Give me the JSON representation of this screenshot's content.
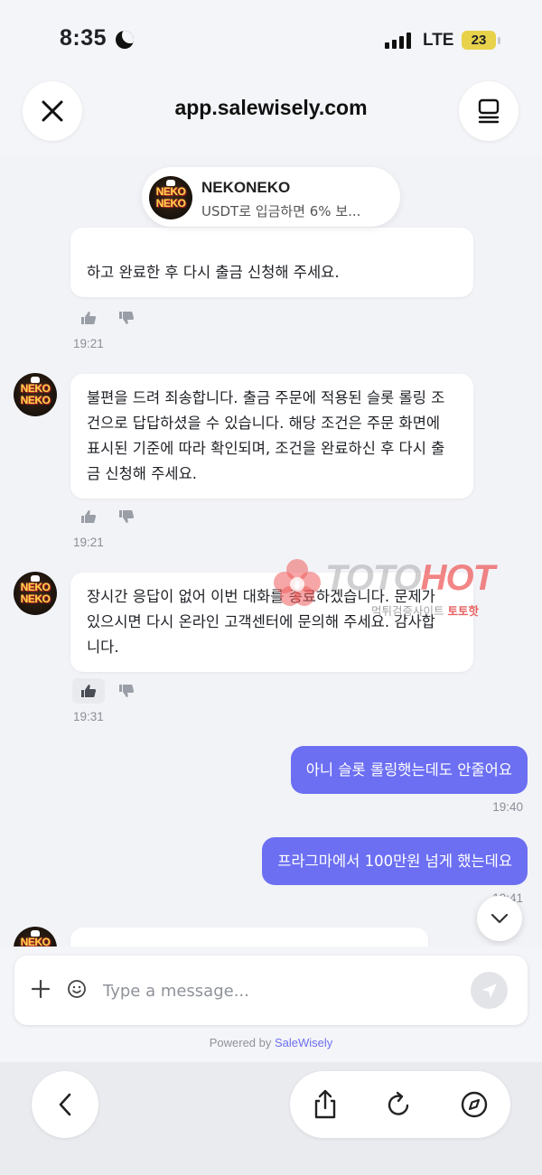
{
  "status_bar": {
    "time": "8:35",
    "network": "LTE",
    "battery": "23"
  },
  "browser": {
    "url": "app.salewisely.com"
  },
  "chat": {
    "header_pill": {
      "name": "NEKONEKO",
      "preview": "USDT로 입금하면 6% 보..."
    },
    "logo_text": [
      "NEKO",
      "NEKO"
    ],
    "messages": [
      {
        "type": "agent",
        "lines": [
          "하고 완료한 후 다시 출금 신청해 주세요."
        ],
        "time": "19:21",
        "liked": false
      },
      {
        "type": "agent",
        "lines": [
          "불편을 드려 죄송합니다. 출금 주문에 적용된 슬롯 롤링 조",
          "건으로 답답하셨을 수 있습니다. 해당 조건은 주문 화면에",
          "표시된 기준에 따라 확인되며, 조건을 완료하신 후 다시 출",
          "금 신청해 주세요."
        ],
        "time": "19:21",
        "liked": false
      },
      {
        "type": "agent",
        "lines": [
          "장시간 응답이 없어 이번 대화를 종료하겠습니다. 문제가",
          "있으시면 다시 온라인 고객센터에 문의해 주세요. 감사합",
          "니다."
        ],
        "time": "19:31",
        "liked": true
      },
      {
        "type": "user",
        "text": "아니 슬롯 롤링햇는데도 안줄어요",
        "time": "19:40"
      },
      {
        "type": "user",
        "text": "프라그마에서 100만원 넘게 했는데요",
        "time": "19:41"
      }
    ]
  },
  "watermark": {
    "brand_a": "TOTO",
    "brand_b": "HOT",
    "sub_a": "먹튀검증사이트 ",
    "sub_b": "토토핫"
  },
  "composer": {
    "placeholder": "Type a message...",
    "powered_prefix": "Powered by ",
    "powered_brand": "SaleWisely"
  },
  "colors": {
    "accent": "#6c6ff2",
    "background": "#f2f3f7",
    "bubble_in": "#ffffff"
  },
  "icons": [
    "close-icon",
    "tabs-icon",
    "thumbs-up-icon",
    "thumbs-down-icon",
    "chevron-down-icon",
    "plus-icon",
    "emoji-icon",
    "send-icon",
    "back-icon",
    "share-icon",
    "reload-icon",
    "compass-icon"
  ]
}
